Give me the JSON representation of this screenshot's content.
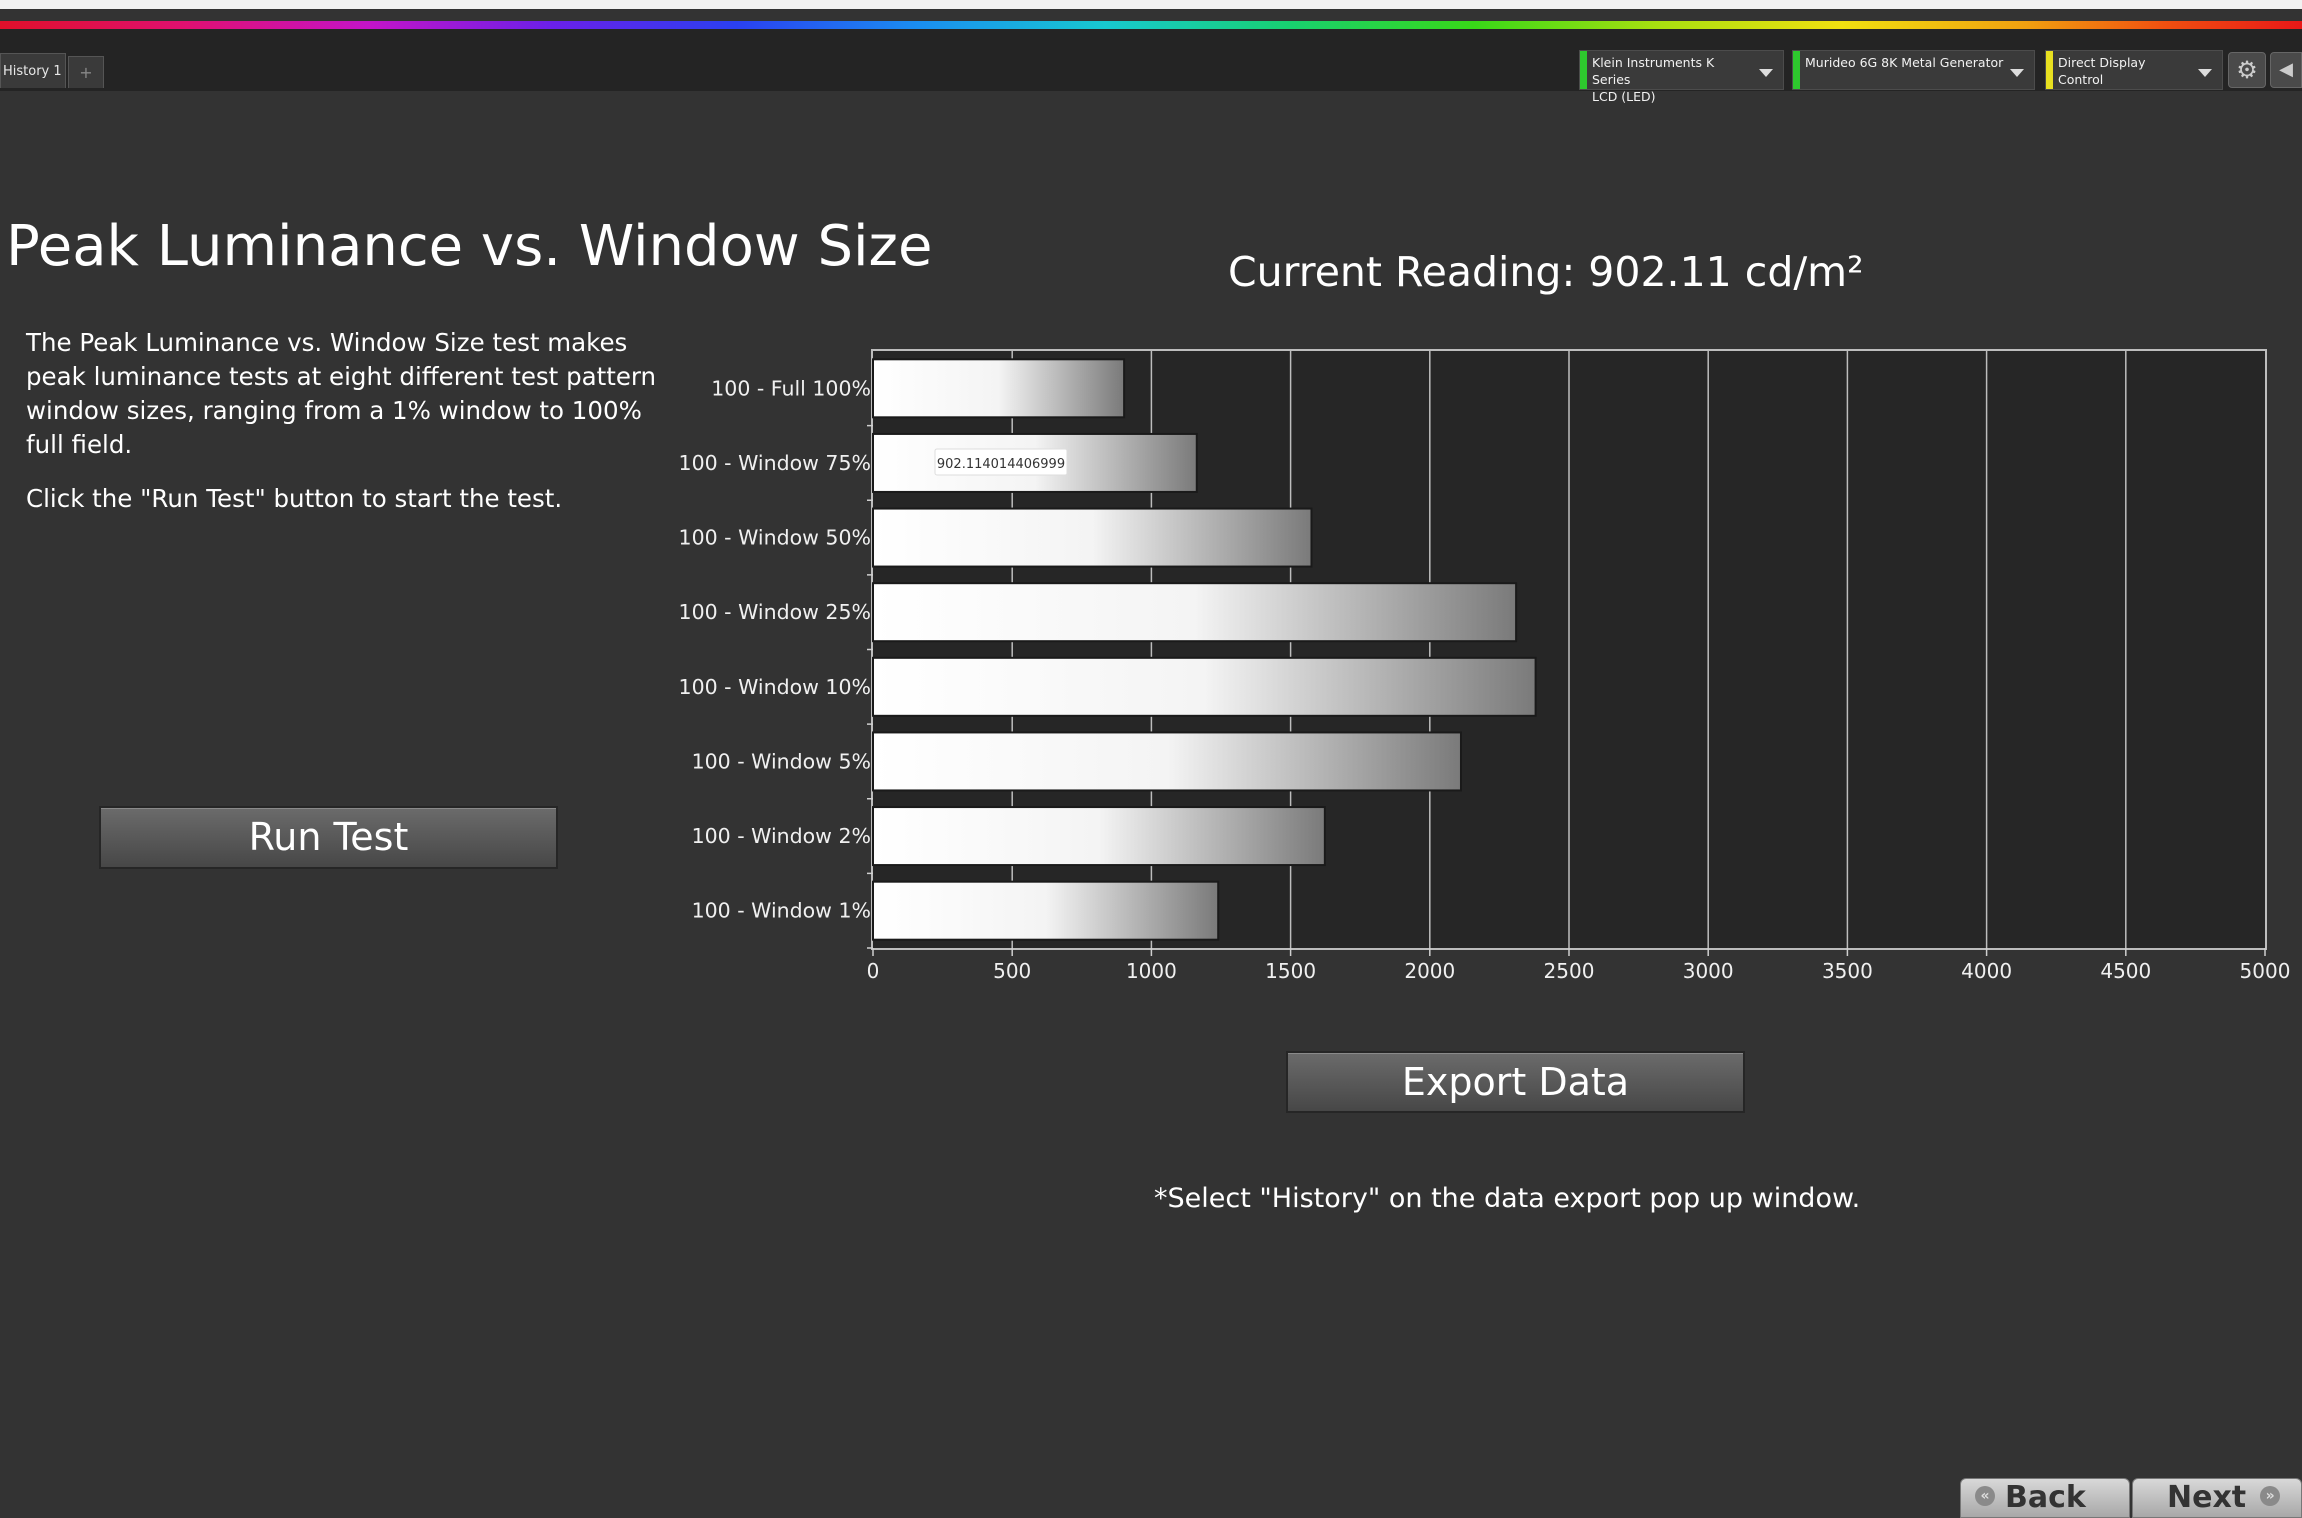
{
  "tabs": [
    {
      "label": "History 1"
    }
  ],
  "add_tab": "+",
  "devices": [
    {
      "line1": "Klein Instruments K Series",
      "line2": "LCD (LED)",
      "status_color": "#2ec82e"
    },
    {
      "line1": "Murideo 6G 8K Metal Generator",
      "line2": "",
      "status_color": "#2ec82e"
    },
    {
      "line1": "Direct Display Control",
      "line2": "",
      "status_color": "#e8e020"
    }
  ],
  "settings_icon": "⚙",
  "collapse_icon": "◀",
  "page_title": "Peak Luminance vs. Window Size",
  "description": {
    "p1": "The Peak Luminance vs. Window Size test makes peak luminance tests at eight different test pattern window sizes, ranging from a 1% window to 100% full field.",
    "p2": "Click the \"Run Test\" button to start the test."
  },
  "run_test_label": "Run Test",
  "current_reading": "Current Reading: 902.11 cd/m²",
  "export_label": "Export  Data",
  "export_note": "*Select \"History\" on the data export pop up window.",
  "nav": {
    "back_label": "Back",
    "next_label": "Next"
  },
  "colors": {
    "background": "#333333",
    "plot_background": "#262626",
    "bar_fill_start": "#ffffff",
    "bar_fill_end": "#808080",
    "grid": "#bdbdbd"
  },
  "chart_data": {
    "type": "bar",
    "orientation": "horizontal",
    "title": "",
    "xlabel": "",
    "ylabel": "",
    "categories": [
      "100 - Full  100%",
      "100 - Window 75%",
      "100 - Window 50%",
      "100 - Window 25%",
      "100 - Window 10%",
      "100 - Window  5%",
      "100 - Window  2%",
      "100 - Window  1%"
    ],
    "values": [
      902,
      1163,
      1575,
      2310,
      2380,
      2112,
      1623,
      1240
    ],
    "xlim": [
      0,
      5000
    ],
    "xticks": [
      "0",
      "500",
      "1000",
      "1500",
      "2000",
      "2500",
      "3000",
      "3500",
      "4000",
      "4500",
      "5000"
    ],
    "grid": "vertical",
    "tooltip": {
      "category_index": 1,
      "text": "902.114014406999"
    }
  }
}
